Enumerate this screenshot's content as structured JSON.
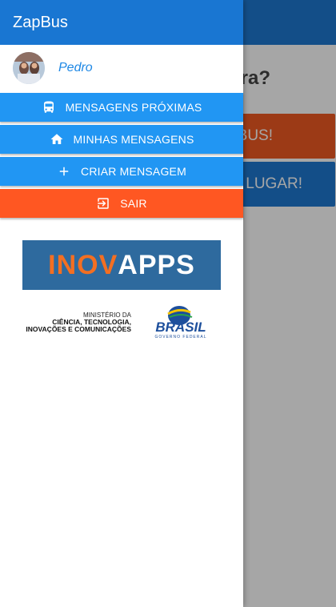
{
  "background": {
    "question_partial": "ra?",
    "button_orange_partial": "BUS!",
    "button_blue_partial": "LUGAR!"
  },
  "drawer": {
    "title": "ZapBus",
    "user": {
      "name": "Pedro"
    },
    "menu": [
      {
        "label": "MENSAGENS PRÓXIMAS",
        "icon": "bus-icon",
        "color": "#2196f3"
      },
      {
        "label": "MINHAS MENSAGENS",
        "icon": "home-icon",
        "color": "#2196f3"
      },
      {
        "label": "CRIAR MENSAGEM",
        "icon": "plus-icon",
        "color": "#2196f3"
      },
      {
        "label": "SAIR",
        "icon": "exit-icon",
        "color": "#ff5722"
      }
    ],
    "logos": {
      "inovapps": {
        "part1": "INOV",
        "part2": "APPS"
      },
      "ministry": {
        "line1": "MINISTÉRIO DA",
        "line2": "CIÊNCIA, TECNOLOGIA,",
        "line3": "INOVAÇÕES E COMUNICAÇÕES"
      },
      "brasil": {
        "text": "BRASIL",
        "subtitle": "GOVERNO FEDERAL"
      }
    }
  },
  "colors": {
    "primary": "#1976d2",
    "menu_blue": "#2196f3",
    "menu_orange": "#ff5722",
    "link_blue": "#1e88e5"
  }
}
